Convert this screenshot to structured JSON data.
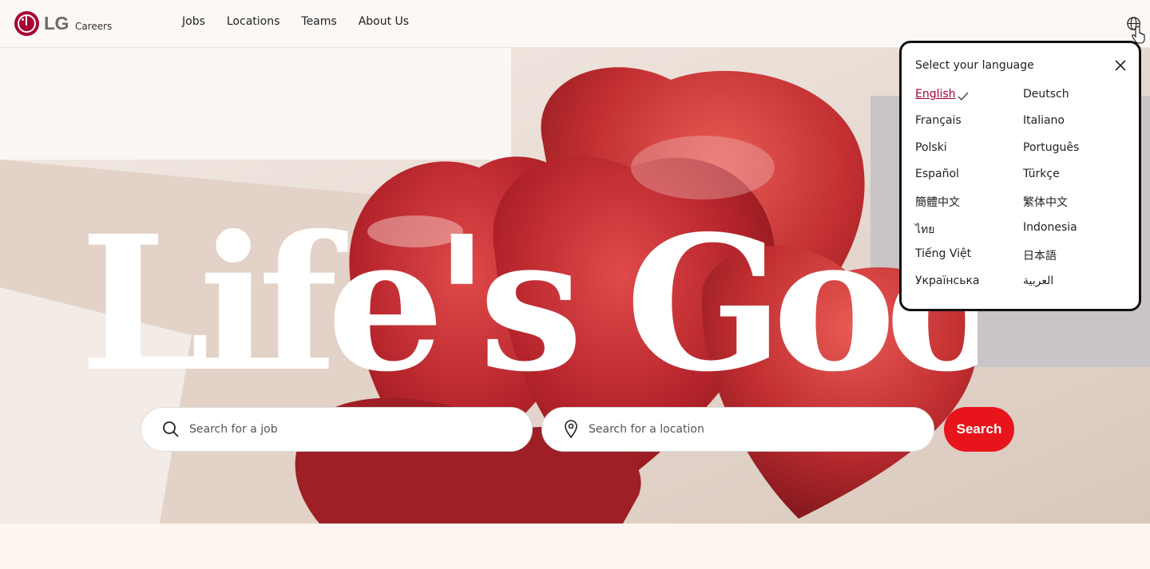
{
  "header": {
    "logo_text": "LG",
    "logo_sub": "Careers",
    "nav": [
      "Jobs",
      "Locations",
      "Teams",
      "About Us"
    ]
  },
  "hero": {
    "headline": "Life's Good"
  },
  "search": {
    "job_placeholder": "Search for a job",
    "location_placeholder": "Search for a location",
    "button_label": "Search"
  },
  "language_panel": {
    "title": "Select your language",
    "selected": "English",
    "languages": [
      "English",
      "Deutsch",
      "Français",
      "Italiano",
      "Polski",
      "Português",
      "Español",
      "Türkçe",
      "簡體中文",
      "繁体中文",
      "ไทย",
      "Indonesia",
      "Tiếng Việt",
      "日本語",
      "Українська",
      "العربية"
    ]
  },
  "colors": {
    "brand": "#a50034",
    "search_button": "#e8141c"
  },
  "icons": [
    "globe-icon",
    "cursor-icon",
    "close-icon",
    "check-icon",
    "search-icon",
    "location-pin-icon"
  ]
}
